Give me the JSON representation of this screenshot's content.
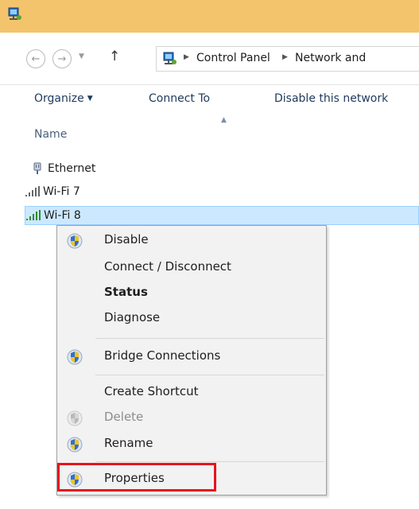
{
  "breadcrumb": [
    "Control Panel",
    "Network and"
  ],
  "toolbar": {
    "organize": "Organize",
    "connect_to": "Connect To",
    "disable_network": "Disable this network"
  },
  "list_header": {
    "name": "Name"
  },
  "items": [
    {
      "label": "Ethernet",
      "icon": "ethernet-adapter-icon"
    },
    {
      "label": "Wi-Fi 7",
      "icon": "wifi-signal-icon"
    },
    {
      "label": "Wi-Fi 8",
      "icon": "wifi-signal-icon",
      "selected": true
    }
  ],
  "context_menu": [
    {
      "label": "Disable",
      "shield": "color",
      "bold": false,
      "disabled": false
    },
    {
      "label": "Connect / Disconnect",
      "shield": "none",
      "bold": false,
      "disabled": false
    },
    {
      "label": "Status",
      "shield": "none",
      "bold": true,
      "disabled": false
    },
    {
      "label": "Diagnose",
      "shield": "none",
      "bold": false,
      "disabled": false
    },
    {
      "label": "Bridge Connections",
      "shield": "color",
      "bold": false,
      "disabled": false
    },
    {
      "label": "Create Shortcut",
      "shield": "none",
      "bold": false,
      "disabled": false
    },
    {
      "label": "Delete",
      "shield": "gray",
      "bold": false,
      "disabled": true
    },
    {
      "label": "Rename",
      "shield": "color",
      "bold": false,
      "disabled": false
    },
    {
      "label": "Properties",
      "shield": "color",
      "bold": false,
      "disabled": false,
      "highlighted": true
    }
  ],
  "colors": {
    "titlebar": "#f3c46b",
    "selection": "#cce8ff",
    "highlight": "#e8141c"
  }
}
